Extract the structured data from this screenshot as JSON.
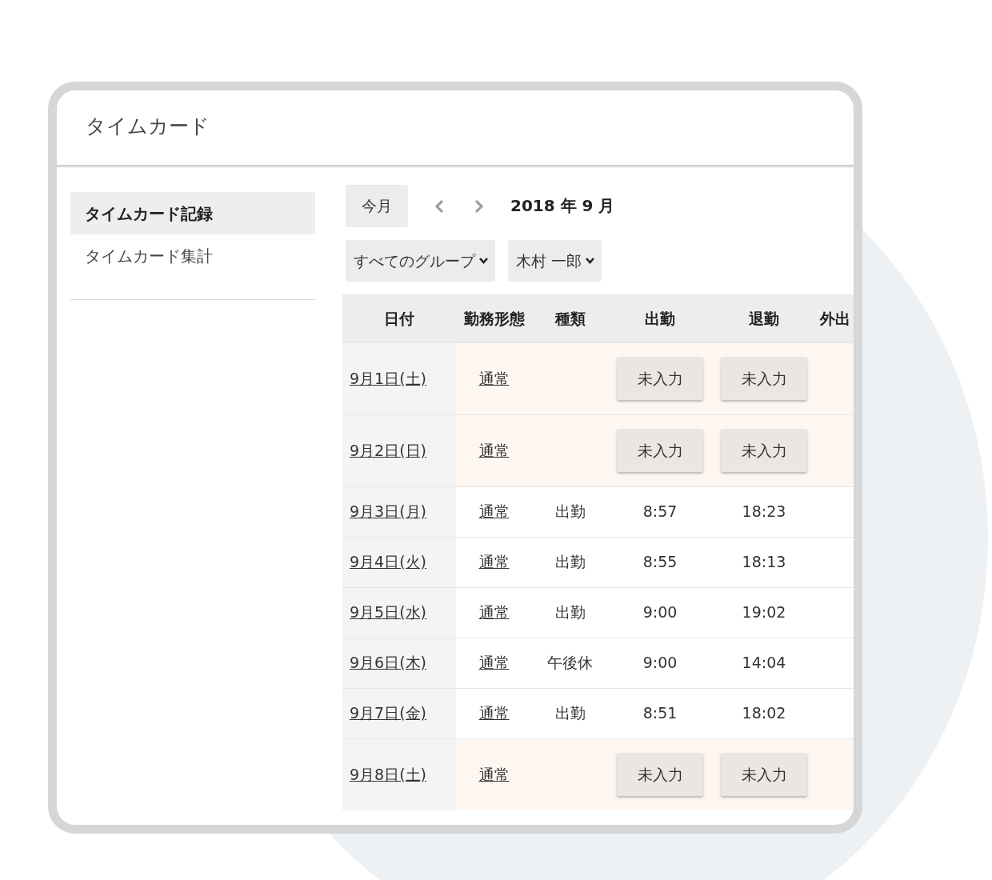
{
  "title": "タイムカード",
  "sidebar": {
    "items": [
      {
        "label": "タイムカード記録",
        "selected": true
      },
      {
        "label": "タイムカード集計",
        "selected": false
      }
    ]
  },
  "toolbar": {
    "today_button": "今月",
    "month": "2018 年 9 月",
    "filters": [
      "すべてのグループ",
      "木村 一郎"
    ]
  },
  "table": {
    "columns": [
      "日付",
      "勤務形態",
      "種類",
      "出勤",
      "退勤",
      "外出"
    ],
    "rows": [
      {
        "kind": "missing",
        "date": "9月1日(土)",
        "style": "通常",
        "clock_in": "未入力",
        "clock_out": "未入力"
      },
      {
        "kind": "missing",
        "date": "9月2日(日)",
        "style": "通常",
        "clock_in": "未入力",
        "clock_out": "未入力"
      },
      {
        "kind": "worked",
        "date": "9月3日(月)",
        "style": "通常",
        "type": "出勤",
        "clock_in": "8:57",
        "clock_out": "18:23"
      },
      {
        "kind": "worked",
        "date": "9月4日(火)",
        "style": "通常",
        "type": "出勤",
        "clock_in": "8:55",
        "clock_out": "18:13"
      },
      {
        "kind": "worked",
        "date": "9月5日(水)",
        "style": "通常",
        "type": "出勤",
        "clock_in": "9:00",
        "clock_out": "19:02"
      },
      {
        "kind": "worked",
        "date": "9月6日(木)",
        "style": "通常",
        "type": "午後休",
        "clock_in": "9:00",
        "clock_out": "14:04"
      },
      {
        "kind": "worked",
        "date": "9月7日(金)",
        "style": "通常",
        "type": "出勤",
        "clock_in": "8:51",
        "clock_out": "18:02"
      },
      {
        "kind": "missing",
        "date": "9月8日(土)",
        "style": "通常",
        "clock_in": "未入力",
        "clock_out": "未入力"
      }
    ]
  }
}
